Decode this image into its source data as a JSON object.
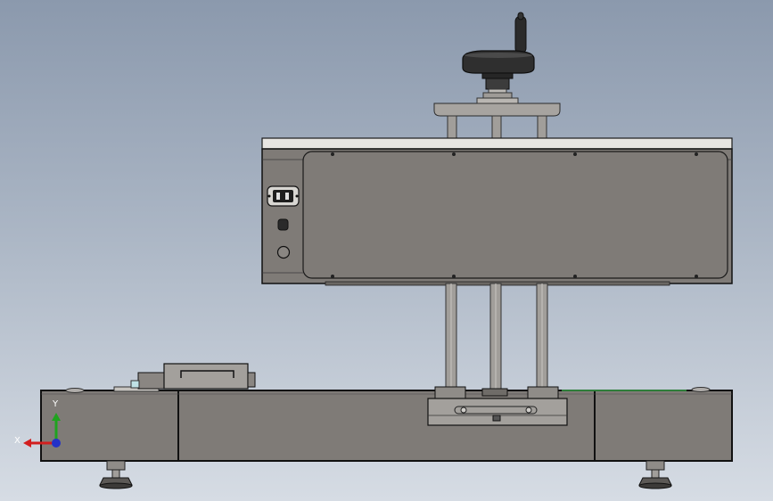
{
  "viewport": {
    "background_top": "#8b99ad",
    "background_bottom": "#d6dce4"
  },
  "model": {
    "body_color": "#7f7b77",
    "edge_color": "#111111",
    "rod_color": "#a19e9a",
    "handwheel_color": "#2b2b2b",
    "top_strip_color": "#e8e6e2"
  },
  "triad": {
    "x_label": "X",
    "y_label": "Y",
    "x_color": "#d21e1e",
    "y_color": "#1fa31f",
    "z_color": "#2332c8"
  }
}
